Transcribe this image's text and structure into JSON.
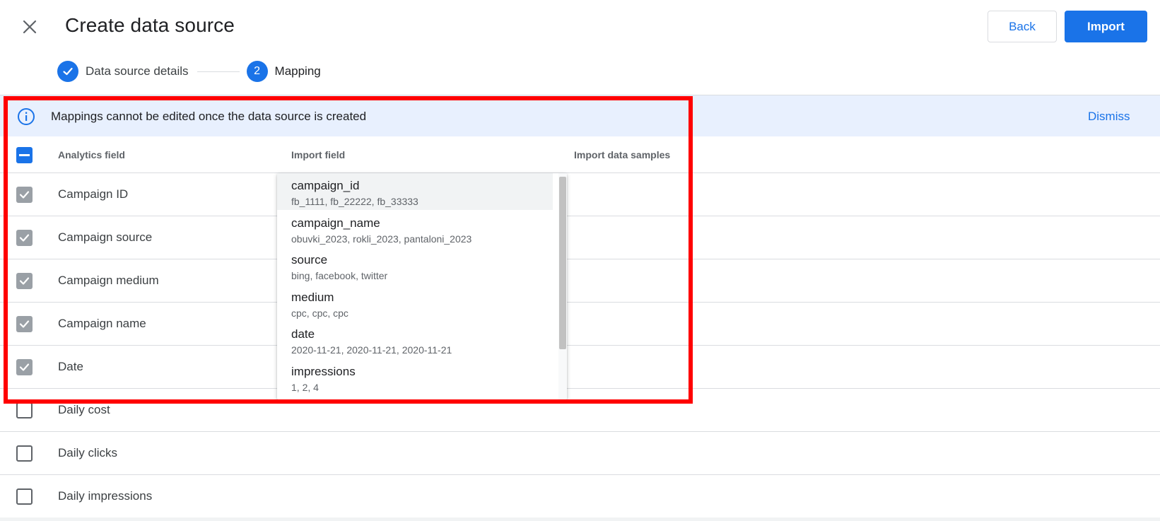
{
  "header": {
    "title": "Create data source",
    "back_label": "Back",
    "import_label": "Import"
  },
  "stepper": {
    "steps": [
      {
        "label": "Data source details",
        "state": "done"
      },
      {
        "label": "Mapping",
        "number": "2",
        "state": "active"
      }
    ]
  },
  "banner": {
    "text": "Mappings cannot be edited once the data source is created",
    "dismiss_label": "Dismiss"
  },
  "table": {
    "columns": [
      "Analytics field",
      "Import field",
      "Import data samples"
    ],
    "rows": [
      {
        "label": "Campaign ID",
        "checked": true
      },
      {
        "label": "Campaign source",
        "checked": true
      },
      {
        "label": "Campaign medium",
        "checked": true
      },
      {
        "label": "Campaign name",
        "checked": true
      },
      {
        "label": "Date",
        "checked": true
      },
      {
        "label": "Daily cost",
        "checked": false
      },
      {
        "label": "Daily clicks",
        "checked": false
      },
      {
        "label": "Daily impressions",
        "checked": false
      }
    ]
  },
  "dropdown": {
    "options": [
      {
        "name": "campaign_id",
        "sample": "fb_1111, fb_22222, fb_33333"
      },
      {
        "name": "campaign_name",
        "sample": "obuvki_2023, rokli_2023, pantaloni_2023"
      },
      {
        "name": "source",
        "sample": "bing, facebook, twitter"
      },
      {
        "name": "medium",
        "sample": "cpc, cpc, cpc"
      },
      {
        "name": "date",
        "sample": "2020-11-21, 2020-11-21, 2020-11-21"
      },
      {
        "name": "impressions",
        "sample": "1, 2, 4"
      }
    ]
  },
  "colors": {
    "accent": "#1a73e8",
    "highlight": "#ff0000",
    "banner_bg": "#e8f0fe"
  }
}
